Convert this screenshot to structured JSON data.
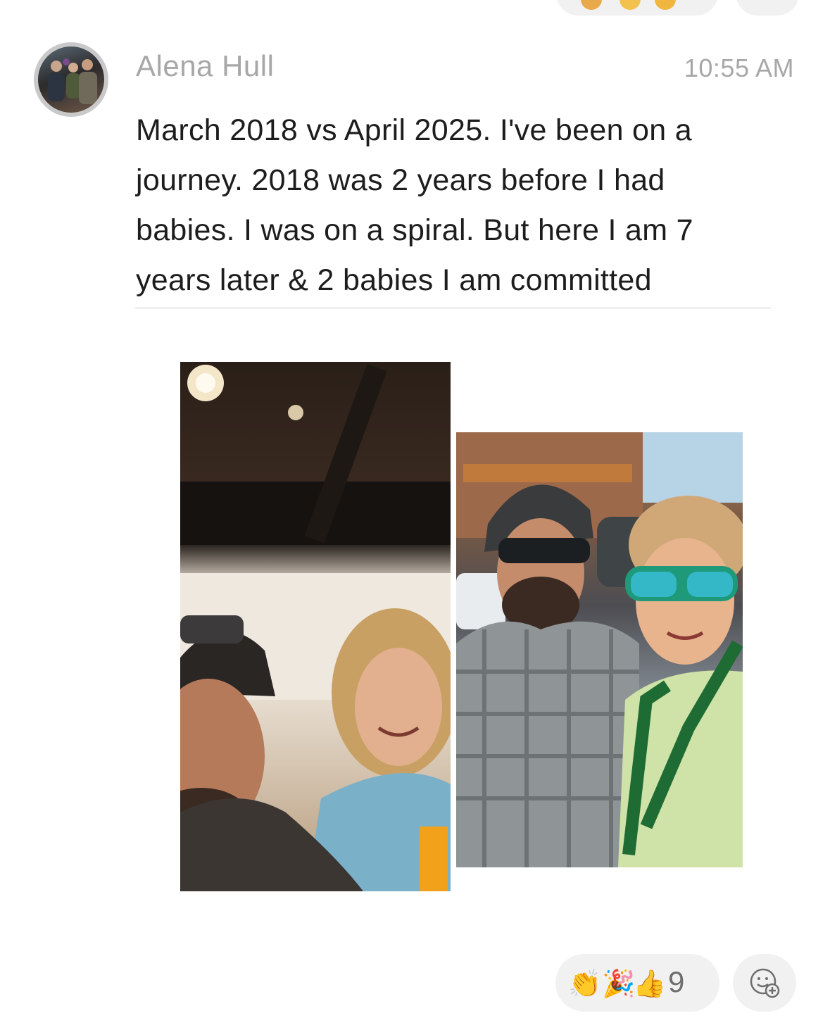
{
  "message": {
    "author": "Alena Hull",
    "time": "10:55 AM",
    "text": "March 2018 vs April 2025. I've been on a journey. 2018 was 2 years before I had babies. I was on a spiral. But here I am 7 years later & 2 babies I am committed",
    "text_lines": [
      "March 2018 vs April 2025. I've been on a",
      "journey. 2018 was 2 years before I had",
      "babies. I was on a spiral. But here I am 7",
      "years later & 2 babies I am committed"
    ]
  },
  "reactions": {
    "icons": [
      "clapping-hands-icon",
      "party-popper-icon",
      "thumbs-up-icon"
    ],
    "emoji": [
      "👏",
      "🎉",
      "👍"
    ],
    "count": "9"
  },
  "colors": {
    "meta_text": "#a7a7a7",
    "body_text": "#1d1d1d",
    "pill_bg": "#f1f1f1",
    "divider": "#c9c9c9"
  }
}
